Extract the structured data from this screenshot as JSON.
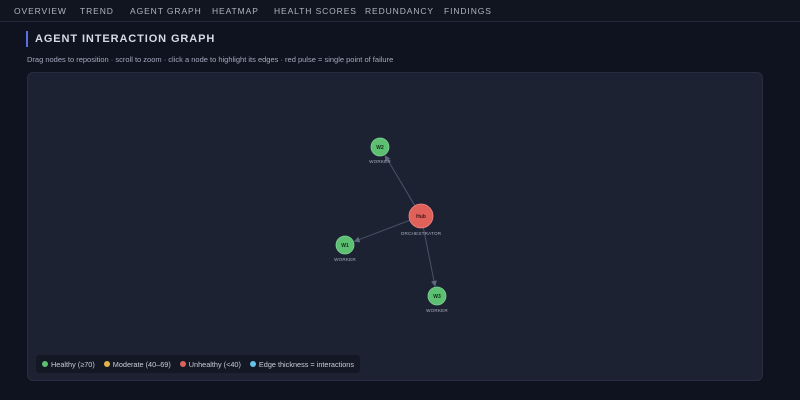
{
  "nav": {
    "tabs": [
      {
        "label": "OVERVIEW"
      },
      {
        "label": "TREND"
      },
      {
        "label": "AGENT GRAPH"
      },
      {
        "label": "HEATMAP"
      },
      {
        "label": "HEALTH SCORES"
      },
      {
        "label": "REDUNDANCY"
      },
      {
        "label": "FINDINGS"
      }
    ]
  },
  "section": {
    "title": "AGENT INTERACTION GRAPH",
    "hint": "Drag nodes to reposition · scroll to zoom · click a node to highlight its edges · red pulse = single point of failure"
  },
  "graph": {
    "nodes": [
      {
        "id": "W2",
        "label": "W2",
        "role": "WORKER",
        "health": "healthy"
      },
      {
        "id": "Hub",
        "label": "Hub",
        "role": "ORCHESTRATOR",
        "health": "unhealthy"
      },
      {
        "id": "W1",
        "label": "W1",
        "role": "WORKER",
        "health": "healthy"
      },
      {
        "id": "W3",
        "label": "W3",
        "role": "WORKER",
        "health": "healthy"
      }
    ],
    "edges": [
      {
        "from": "Hub",
        "to": "W2"
      },
      {
        "from": "Hub",
        "to": "W1"
      },
      {
        "from": "Hub",
        "to": "W3"
      }
    ]
  },
  "legend": {
    "healthy": "Healthy (≥70)",
    "moderate": "Moderate (40–69)",
    "unhealthy": "Unhealthy (<40)",
    "edge": "Edge thickness = interactions"
  },
  "colors": {
    "healthy": "#5cbf72",
    "moderate": "#e3b24a",
    "unhealthy": "#e0605a",
    "edge_legend": "#66c2e9",
    "accent": "#5c6fe0"
  }
}
